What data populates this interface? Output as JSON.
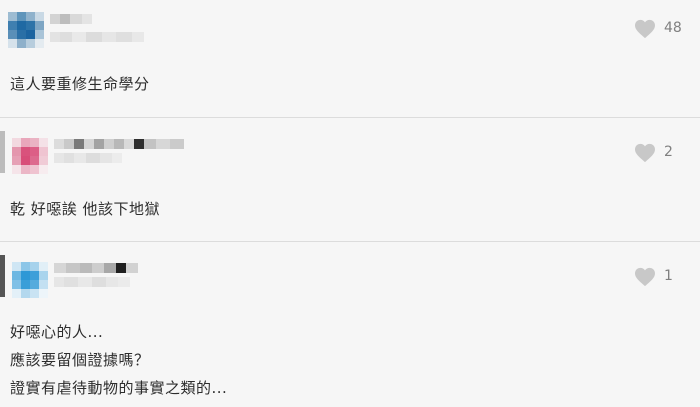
{
  "comments": [
    {
      "likes": "48",
      "lines": [
        "這人要重修生命學分"
      ]
    },
    {
      "likes": "2",
      "lines": [
        "乾 好噁誒 他該下地獄"
      ]
    },
    {
      "likes": "1",
      "lines": [
        "好噁心的人...",
        "應該要留個證據嗎？",
        "證實有虐待動物的事實之類的..."
      ]
    }
  ],
  "colors": {
    "heart": "#c8c8c8",
    "likeCount": "#808080",
    "divider": "#dcdcdc",
    "background": "#f6f6f6"
  },
  "icons": {
    "like": "heart-icon"
  }
}
